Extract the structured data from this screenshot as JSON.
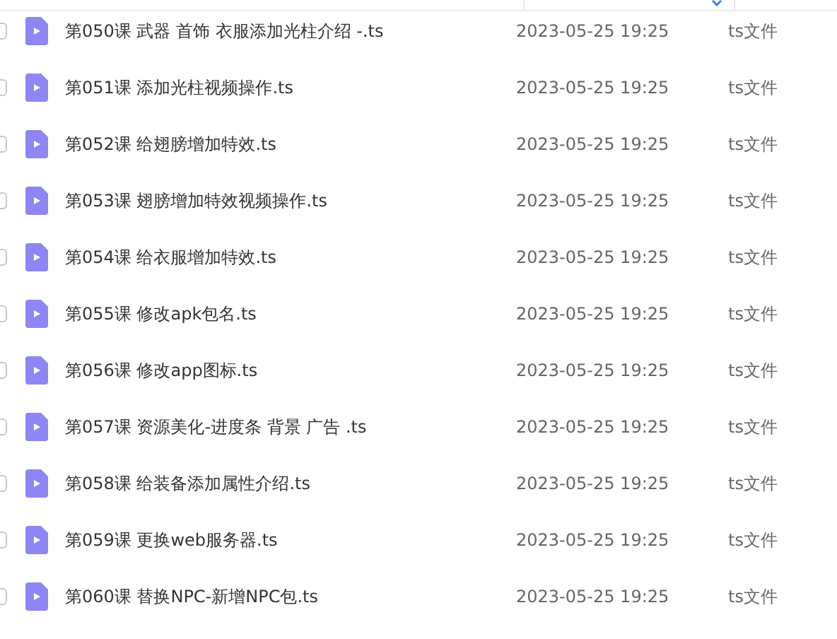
{
  "files": [
    {
      "name": "第050课 武器 首饰 衣服添加光柱介绍 -.ts",
      "modified": "2023-05-25 19:25",
      "type": "ts文件",
      "checked": false
    },
    {
      "name": "第051课 添加光柱视频操作.ts",
      "modified": "2023-05-25 19:25",
      "type": "ts文件",
      "checked": false
    },
    {
      "name": "第052课 给翅膀增加特效.ts",
      "modified": "2023-05-25 19:25",
      "type": "ts文件",
      "checked": false
    },
    {
      "name": "第053课 翅膀增加特效视频操作.ts",
      "modified": "2023-05-25 19:25",
      "type": "ts文件",
      "checked": false
    },
    {
      "name": "第054课 给衣服增加特效.ts",
      "modified": "2023-05-25 19:25",
      "type": "ts文件",
      "checked": false
    },
    {
      "name": "第055课 修改apk包名.ts",
      "modified": "2023-05-25 19:25",
      "type": "ts文件",
      "checked": false
    },
    {
      "name": "第056课 修改app图标.ts",
      "modified": "2023-05-25 19:25",
      "type": "ts文件",
      "checked": false
    },
    {
      "name": "第057课 资源美化-进度条 背景 广告 .ts",
      "modified": "2023-05-25 19:25",
      "type": "ts文件",
      "checked": false
    },
    {
      "name": "第058课 给装备添加属性介绍.ts",
      "modified": "2023-05-25 19:25",
      "type": "ts文件",
      "checked": false
    },
    {
      "name": "第059课 更换web服务器.ts",
      "modified": "2023-05-25 19:25",
      "type": "ts文件",
      "checked": false
    },
    {
      "name": "第060课 替换NPC-新增NPC包.ts",
      "modified": "2023-05-25 19:25",
      "type": "ts文件",
      "checked": false
    }
  ]
}
